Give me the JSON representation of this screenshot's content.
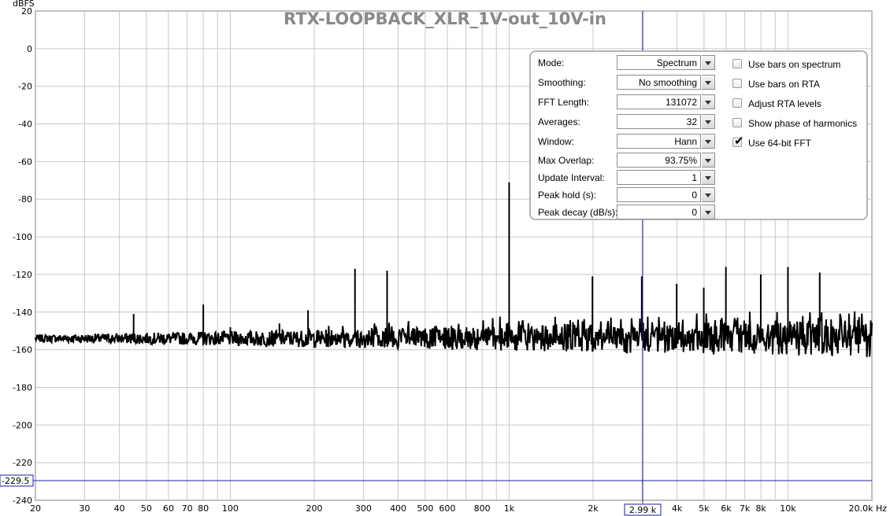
{
  "window_title": "RTX-LOOPBACK_XLR_1V-out_10V-in",
  "y_unit": "dBFS",
  "x_unit": "Hz",
  "cursor": {
    "freq_label": "2.99 k",
    "level_label": "-229.5"
  },
  "settings": {
    "rows": [
      {
        "label": "Mode:",
        "value": "Spectrum"
      },
      {
        "label": "Smoothing:",
        "value": "No  smoothing"
      },
      {
        "label": "FFT Length:",
        "value": "131072"
      },
      {
        "label": "Averages:",
        "value": "32"
      },
      {
        "label": "Window:",
        "value": "Hann"
      },
      {
        "label": "Max Overlap:",
        "value": "93.75%"
      },
      {
        "label": "Update Interval:",
        "value": "1"
      },
      {
        "label": "Peak hold (s):",
        "value": "0"
      },
      {
        "label": "Peak decay (dB/s):",
        "value": "0"
      }
    ],
    "checkboxes": [
      {
        "label": "Use bars on spectrum",
        "checked": false
      },
      {
        "label": "Use bars on RTA",
        "checked": false
      },
      {
        "label": "Adjust RTA levels",
        "checked": false
      },
      {
        "label": "Show phase of harmonics",
        "checked": false
      },
      {
        "label": "Use 64-bit FFT",
        "checked": true
      }
    ]
  },
  "chart_data": {
    "type": "line",
    "title": "RTX-LOOPBACK_XLR_1V-out_10V-in",
    "ylabel": "dBFS",
    "xlabel": "Hz",
    "x_scale": "log",
    "xlim": [
      20,
      20000
    ],
    "ylim": [
      -240,
      20
    ],
    "grid": true,
    "y_ticks": [
      "20",
      "0",
      "-20",
      "-40",
      "-60",
      "-80",
      "-100",
      "-120",
      "-140",
      "-160",
      "-180",
      "-200",
      "-220",
      "-240"
    ],
    "x_ticks": [
      "20",
      "30",
      "40",
      "50",
      "60",
      "70",
      "80",
      "100",
      "200",
      "300",
      "400",
      "500",
      "600",
      "800",
      "1k",
      "2k",
      "3k",
      "4k",
      "5k",
      "6k",
      "7k",
      "8k",
      "10k",
      "20.0k Hz"
    ],
    "noise_floor_db": -153,
    "peaks": {
      "freq": [
        45,
        80,
        100,
        150,
        190,
        280,
        365,
        1000,
        1990,
        2990,
        3990,
        4990,
        5990,
        7990,
        10000,
        13000
      ],
      "level": [
        -141,
        -136,
        -148,
        -146,
        -139,
        -117,
        -118,
        -71,
        -121,
        -121,
        -125,
        -127,
        -116,
        -120,
        -116,
        -119
      ]
    }
  }
}
